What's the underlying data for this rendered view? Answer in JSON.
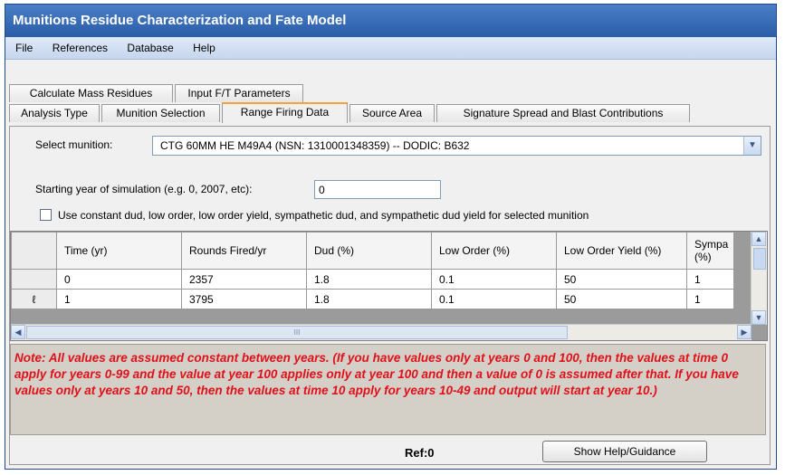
{
  "window": {
    "title": "Munitions Residue Characterization and Fate Model"
  },
  "menu": {
    "items": [
      "File",
      "References",
      "Database",
      "Help"
    ]
  },
  "tabs": {
    "row1": [
      "Calculate Mass Residues",
      "Input F/T Parameters"
    ],
    "row2": [
      "Analysis Type",
      "Munition Selection",
      "Range Firing Data",
      "Source Area",
      "Signature Spread and Blast Contributions"
    ],
    "active": "Range Firing Data"
  },
  "form": {
    "munition_label": "Select munition:",
    "munition_value": "CTG 60MM HE M49A4 (NSN: 1310001348359) -- DODIC: B632",
    "start_year_label": "Starting year of simulation (e.g. 0, 2007, etc):",
    "start_year_value": "0",
    "constant_checkbox_label": "Use constant dud, low order, low order yield, sympathetic dud, and sympathetic dud yield for selected munition",
    "constant_checked": false
  },
  "grid": {
    "columns": [
      "Time (yr)",
      "Rounds Fired/yr",
      "Dud (%)",
      "Low Order (%)",
      "Low Order Yield (%)",
      "Sympa (%)"
    ],
    "rows": [
      [
        "0",
        "2357",
        "1.8",
        "0.1",
        "50",
        "1"
      ],
      [
        "1",
        "3795",
        "1.8",
        "0.1",
        "50",
        "1"
      ]
    ],
    "new_row_indicator": "ℓ",
    "scroll_grip": "III"
  },
  "note": "Note: All values are assumed constant between years.  (If you have values only at years 0 and 100, then the values at time 0 apply for years 0-99 and the value at year 100 applies only at year 100 and then a value of 0 is assumed after that.  If you have values only at years 10 and 50, then the values at time 10 apply for years 10-49 and output will start at year 10.)",
  "footer": {
    "ref": "Ref:0",
    "help_button": "Show Help/Guidance"
  },
  "colors": {
    "title_bar": "#2a5ca8",
    "active_tab_accent": "#f4a33a",
    "note_text": "#e0101a",
    "note_bg": "#d4d0c8"
  }
}
